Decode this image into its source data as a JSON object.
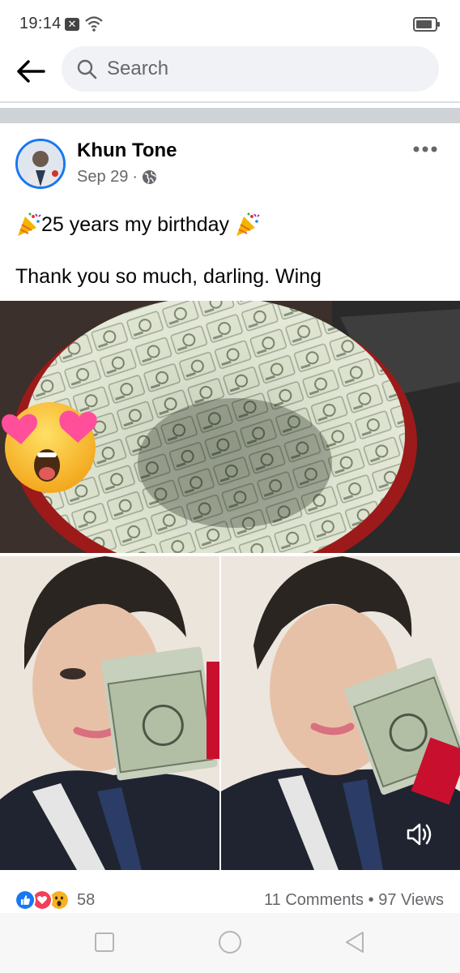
{
  "status_bar": {
    "time": "19:14",
    "wifi_icon": "wifi-icon",
    "battery_icon": "battery-icon",
    "notification_icon": "close-box-icon"
  },
  "header": {
    "back_icon": "arrow-left-icon",
    "search_placeholder": "Search",
    "search_icon": "search-icon"
  },
  "post": {
    "author": "Khun Tone",
    "date": "Sep 29",
    "separator": "·",
    "privacy_icon": "globe-icon",
    "more_icon": "more-horizontal-icon",
    "text_line1": "25 years my birthday",
    "text_line2": "Thank you so much, darling. Wing",
    "emoji_icon": "party-popper-icon",
    "media": [
      {
        "name": "money-bouquet-photo"
      },
      {
        "name": "man-with-dollars-photo-left"
      },
      {
        "name": "man-with-dollars-photo-right"
      }
    ],
    "sticker": "heart-eyes-emoji-icon",
    "volume_icon": "volume-icon"
  },
  "footer": {
    "reaction_icons": [
      "like-icon",
      "love-icon",
      "wow-icon"
    ],
    "reaction_count": "58",
    "comments": "11 Comments",
    "stats_separator": "•",
    "views": "97 Views"
  },
  "nav": {
    "recents_icon": "square-icon",
    "home_icon": "circle-icon",
    "back_icon": "triangle-back-icon"
  },
  "colors": {
    "accent": "#1877f2",
    "muted": "#65676b",
    "text": "#050505",
    "like": "#1877f2",
    "love": "#f33e58",
    "wow": "#f7b125"
  }
}
